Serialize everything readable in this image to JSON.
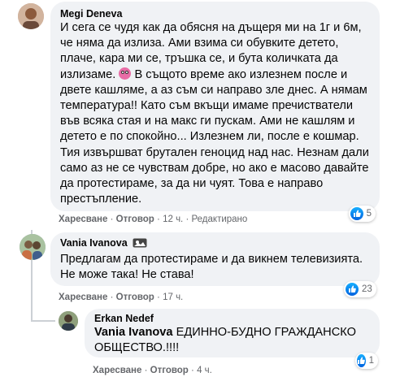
{
  "comments": [
    {
      "author": "Megi Deneva",
      "text_before_emoji": "И сега се чудя как да обясня на дъщеря ми на 1г и 6м, че няма да излиза. Ами взима си обувките детето, плаче, кара ми се, тръшка се, и бута количката да излизаме. ",
      "emoji": "dizzy-face-emoji",
      "text_after_emoji": " В същото време ако излезнем после и двете кашляме, а аз съм си направо зле днес. А нямам температура!! Като съм вкъщи имаме пречистватели във всяка стая и на макс ги пускам. Ами не кашлям и детето е по спокойно... Излезнем ли, после е кошмар. Тия извършват брутален геноцид над нас. Незнам дали само аз не се чувствам добре, но ако е масово давайте да протестираме, за да ни чуят. Това е направо престъпление.",
      "like_label": "Харесване",
      "reply_label": "Отговор",
      "time": "12 ч.",
      "edited": "Редактирано",
      "reaction_count": "5"
    },
    {
      "author": "Vania Ivanova",
      "text": "Предлагам да протестираме и да викнем телевизията. Не може така! Не става!",
      "like_label": "Харесване",
      "reply_label": "Отговор",
      "time": "17 ч.",
      "reaction_count": "23"
    },
    {
      "author": "Erkan Nedef",
      "mention": "Vania Ivanova",
      "text": " ЕДИННО-БУДНО ГРАЖДАНСКО ОБЩЕСТВО.!!!!",
      "like_label": "Харесване",
      "reply_label": "Отговор",
      "time": "4 ч.",
      "reaction_count": "1"
    }
  ],
  "colors": {
    "bubble": "#f0f2f5",
    "meta": "#65676b",
    "like_blue": "#1877f2"
  }
}
